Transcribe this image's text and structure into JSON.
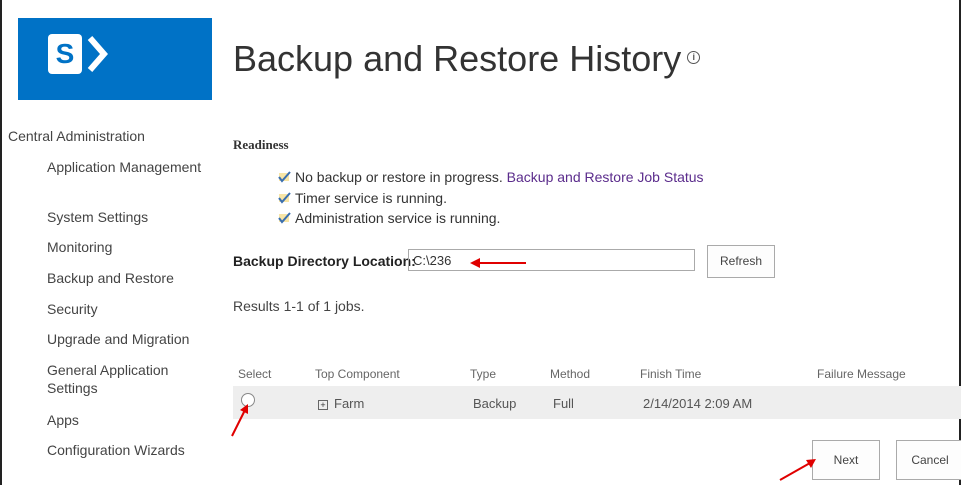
{
  "page": {
    "title": "Backup and Restore History"
  },
  "colors": {
    "brand_blue": "#0072c6",
    "link_purple": "#5b2c8c",
    "annotation_red": "#e00000"
  },
  "nav": {
    "root": "Central Administration",
    "items": [
      {
        "label": "Application Management"
      },
      {
        "label": "System Settings"
      },
      {
        "label": "Monitoring"
      },
      {
        "label": "Backup and Restore"
      },
      {
        "label": "Security"
      },
      {
        "label": "Upgrade and Migration"
      },
      {
        "label": "General Application Settings"
      },
      {
        "label": "Apps"
      },
      {
        "label": "Configuration Wizards"
      }
    ]
  },
  "readiness": {
    "heading": "Readiness",
    "status_1": "No backup or restore in progress.",
    "status_1_link": "Backup and Restore Job Status",
    "status_2": "Timer service is running.",
    "status_3": "Administration service is running."
  },
  "backup_location": {
    "label": "Backup Directory Location:",
    "value": "C:\\236",
    "refresh_label": "Refresh"
  },
  "results": {
    "summary": "Results 1-1 of 1 jobs."
  },
  "table": {
    "headers": [
      "Select",
      "Top Component",
      "Type",
      "Method",
      "Finish Time",
      "Failure Message"
    ],
    "rows": [
      {
        "component": "Farm",
        "type": "Backup",
        "method": "Full",
        "finish_time": "2/14/2014 2:09 AM",
        "failure_message": ""
      }
    ]
  },
  "actions": {
    "next_label": "Next",
    "cancel_label": "Cancel"
  },
  "icons": {
    "logo": "sharepoint-logo-icon",
    "info": "info-icon",
    "check": "check-icon",
    "expand": "expand-plus-icon"
  }
}
